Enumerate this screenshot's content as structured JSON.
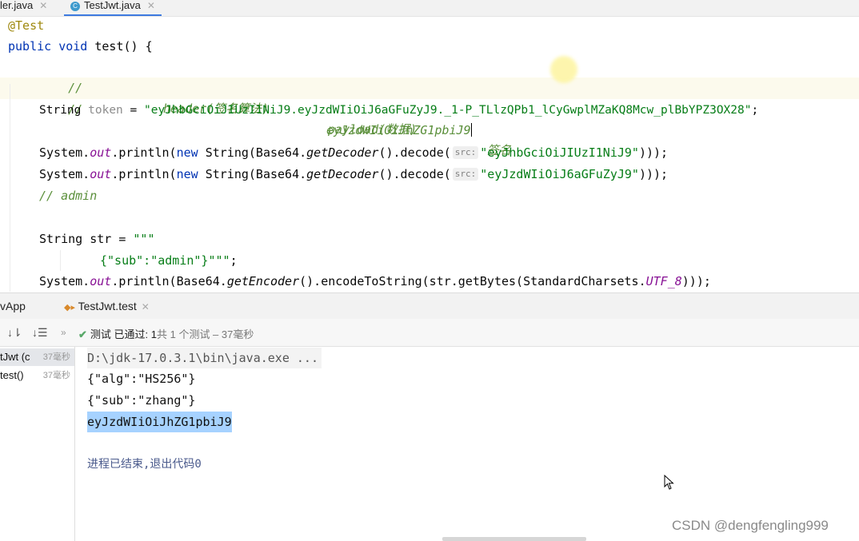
{
  "editor_tabs": [
    {
      "label": "ler.java",
      "active": false
    },
    {
      "label": "TestJwt.java",
      "active": true
    }
  ],
  "code": {
    "annotation": "@Test",
    "signature": {
      "kw1": "public",
      "kw2": "void",
      "name": "test() {"
    },
    "comment1": {
      "slashes": "//",
      "header": "header(签名算法)",
      "payload": "payload(数据)",
      "sign": "签名"
    },
    "comment2": {
      "slashes": "//",
      "value": "eyJzdWIiOiJhZG1pbiJ9"
    },
    "token_line": {
      "type": "String",
      "var": "token",
      "eq": " = ",
      "value": "\"eyJhbGciOiJIUzI1NiJ9.eyJzdWIiOiJ6aGFuZyJ9._1-P_TLlzQPb1_lCyGwplMZaKQ8Mcw_plBbYPZ3OX28\"",
      "end": ";"
    },
    "print1": {
      "pre": "System.",
      "out": "out",
      "mid1": ".println(",
      "new": "new",
      "mid2": " String(Base64.",
      "method": "getDecoder",
      "mid3": "().decode(",
      "hint": "src:",
      "arg": "\"eyJhbGciOiJIUzI1NiJ9\"",
      "end": ")));"
    },
    "print2": {
      "pre": "System.",
      "out": "out",
      "mid1": ".println(",
      "new": "new",
      "mid2": " String(Base64.",
      "method": "getDecoder",
      "mid3": "().decode(",
      "hint": "src:",
      "arg": "\"eyJzdWIiOiJ6aGFuZyJ9\"",
      "end": ")));"
    },
    "comment3": "// admin",
    "str_decl": {
      "type": "String",
      "rest": " str = ",
      "value": "\"\"\""
    },
    "str_body": {
      "value": "{\"sub\":\"admin\"}\"\"\"",
      "end": ";"
    },
    "print3": {
      "pre": "System.",
      "out": "out",
      "mid1": ".println(Base64.",
      "method": "getEncoder",
      "mid2": "().encodeToString(str.getBytes(StandardCharsets.",
      "const": "UTF_8",
      "end": ")));"
    }
  },
  "run_tabs": [
    {
      "label": "vApp"
    },
    {
      "label": "TestJwt.test"
    }
  ],
  "status": {
    "check": "✔",
    "label": "测试 已通过: 1",
    "detail": "共 1 个测试 – 37毫秒"
  },
  "tree": [
    {
      "label": "tJwt (c",
      "time": "37毫秒"
    },
    {
      "label": "test()",
      "time": "37毫秒"
    }
  ],
  "console": [
    "D:\\jdk-17.0.3.1\\bin\\java.exe ...",
    "{\"alg\":\"HS256\"}",
    "{\"sub\":\"zhang\"}",
    "eyJzdWIiOiJhZG1pbiJ9",
    "进程已结束,退出代码0"
  ],
  "watermark": "CSDN @dengfengling999",
  "colors": {
    "accent": "#3d7ae0",
    "pass": "#59a869",
    "selection": "#a6d2ff"
  }
}
